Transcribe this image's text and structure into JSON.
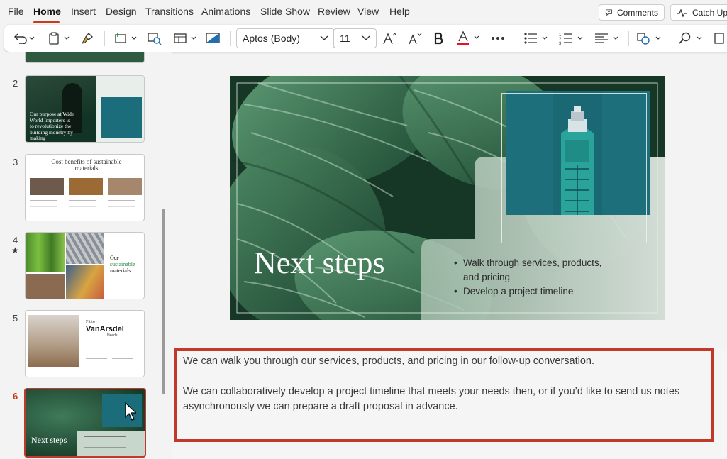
{
  "menu": {
    "items": [
      "File",
      "Home",
      "Insert",
      "Design",
      "Transitions",
      "Animations",
      "Slide Show",
      "Review",
      "View",
      "Help"
    ],
    "comments_label": "Comments",
    "catchup_label": "Catch Up"
  },
  "toolbar": {
    "font_name": "Aptos (Body)",
    "font_size": "11"
  },
  "thumbnails": {
    "numbers": [
      "2",
      "3",
      "4",
      "5",
      "6"
    ],
    "slide2_text": "Our purpose at Wide World Importers is to revolutionize the building industry by making sustainability the norm.",
    "slide3_title": "Cost benefits of sustainable materials",
    "slide4_title_a": "Our",
    "slide4_title_b": "sustainable",
    "slide4_title_c": "materials",
    "slide5_fit": "Fit to",
    "slide5_brand": "VanArsdel",
    "slide5_needs": "Needs",
    "slide6_title": "Next steps"
  },
  "slide": {
    "title": "Next steps",
    "bullets": [
      "Walk through services, products, and pricing",
      "Develop a project timeline"
    ]
  },
  "notes": {
    "line1": "We can walk you through our services, products, and pricing in our follow-up conversation.",
    "line2": "We can collaboratively develop a project timeline that meets your needs then, or if you’d like to send us notes",
    "line3": "asynchronously we can prepare a draft proposal in advance."
  },
  "colors": {
    "accent": "#c43e1c",
    "notes_border": "#c0392b",
    "selected_thumb": "#c0392b"
  }
}
